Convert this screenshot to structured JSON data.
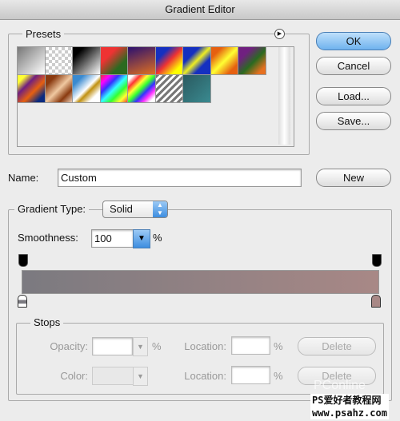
{
  "window": {
    "title": "Gradient Editor"
  },
  "presets": {
    "label": "Presets",
    "menu_icon": "circle-arrow-right-icon",
    "swatches": [
      "linear-gradient(135deg,#777,#fff)",
      "repeating-conic-gradient(#ccc 0 25%,#fff 0 50%) 0 0/8px 8px",
      "linear-gradient(135deg,#000 20%,#fff)",
      "linear-gradient(135deg,#e33 30%,#2a6a20 70%)",
      "linear-gradient(160deg,#2a1070,#e07020)",
      "linear-gradient(135deg,#1530c0 25%,#e33 50%,#ff0 80%)",
      "linear-gradient(135deg,#1530c0 30%,#ee2 50%,#1530c0 70%)",
      "linear-gradient(135deg,#e66010 20%,#ff3 50%,#e66010 80%)",
      "linear-gradient(135deg,#702080 25%,#2a6a20 55%,#e67020 85%)",
      "linear-gradient(135deg,#ff3 15%,#702080 35%,#e66010 60%,#0a2a80 85%)",
      "linear-gradient(135deg,#8a3a10 20%,#f0c8a0 50%,#8a3a10 75%,#f0d8c0)",
      "linear-gradient(135deg,#3a8ad0 20%,#fff 50%,#c09010 60%,#fff 80%)",
      "linear-gradient(135deg,#e33,#f0f,#33f,#3ff,#3f3,#ff3,#e33)",
      "linear-gradient(135deg,#fff 10%,#f33,#ff3,#3f3,#33f,#f3f,#fff 90%)",
      "repeating-linear-gradient(135deg,#777 0 3px,#fff 3px 6px)",
      "linear-gradient(135deg,#2a5a60,#3a8a90)"
    ]
  },
  "buttons": {
    "ok": "OK",
    "cancel": "Cancel",
    "load": "Load...",
    "save": "Save...",
    "new": "New"
  },
  "name": {
    "label": "Name:",
    "value": "Custom"
  },
  "gradient": {
    "type_label": "Gradient Type:",
    "type_value": "Solid",
    "smoothness_label": "Smoothness:",
    "smoothness_value": "100",
    "percent": "%",
    "start_color": "#7b7a80",
    "end_color": "#a88886"
  },
  "stops": {
    "label": "Stops",
    "opacity_label": "Opacity:",
    "opacity_value": "",
    "percent": "%",
    "location_label": "Location:",
    "location_value": "",
    "delete": "Delete",
    "color_label": "Color:",
    "color_location_label": "Location:",
    "color_location_value": "",
    "color_delete": "Delete"
  },
  "watermark": {
    "line1": "PS爱好者教程网",
    "line2": "www.psahz.com",
    "faint": "PConline"
  }
}
